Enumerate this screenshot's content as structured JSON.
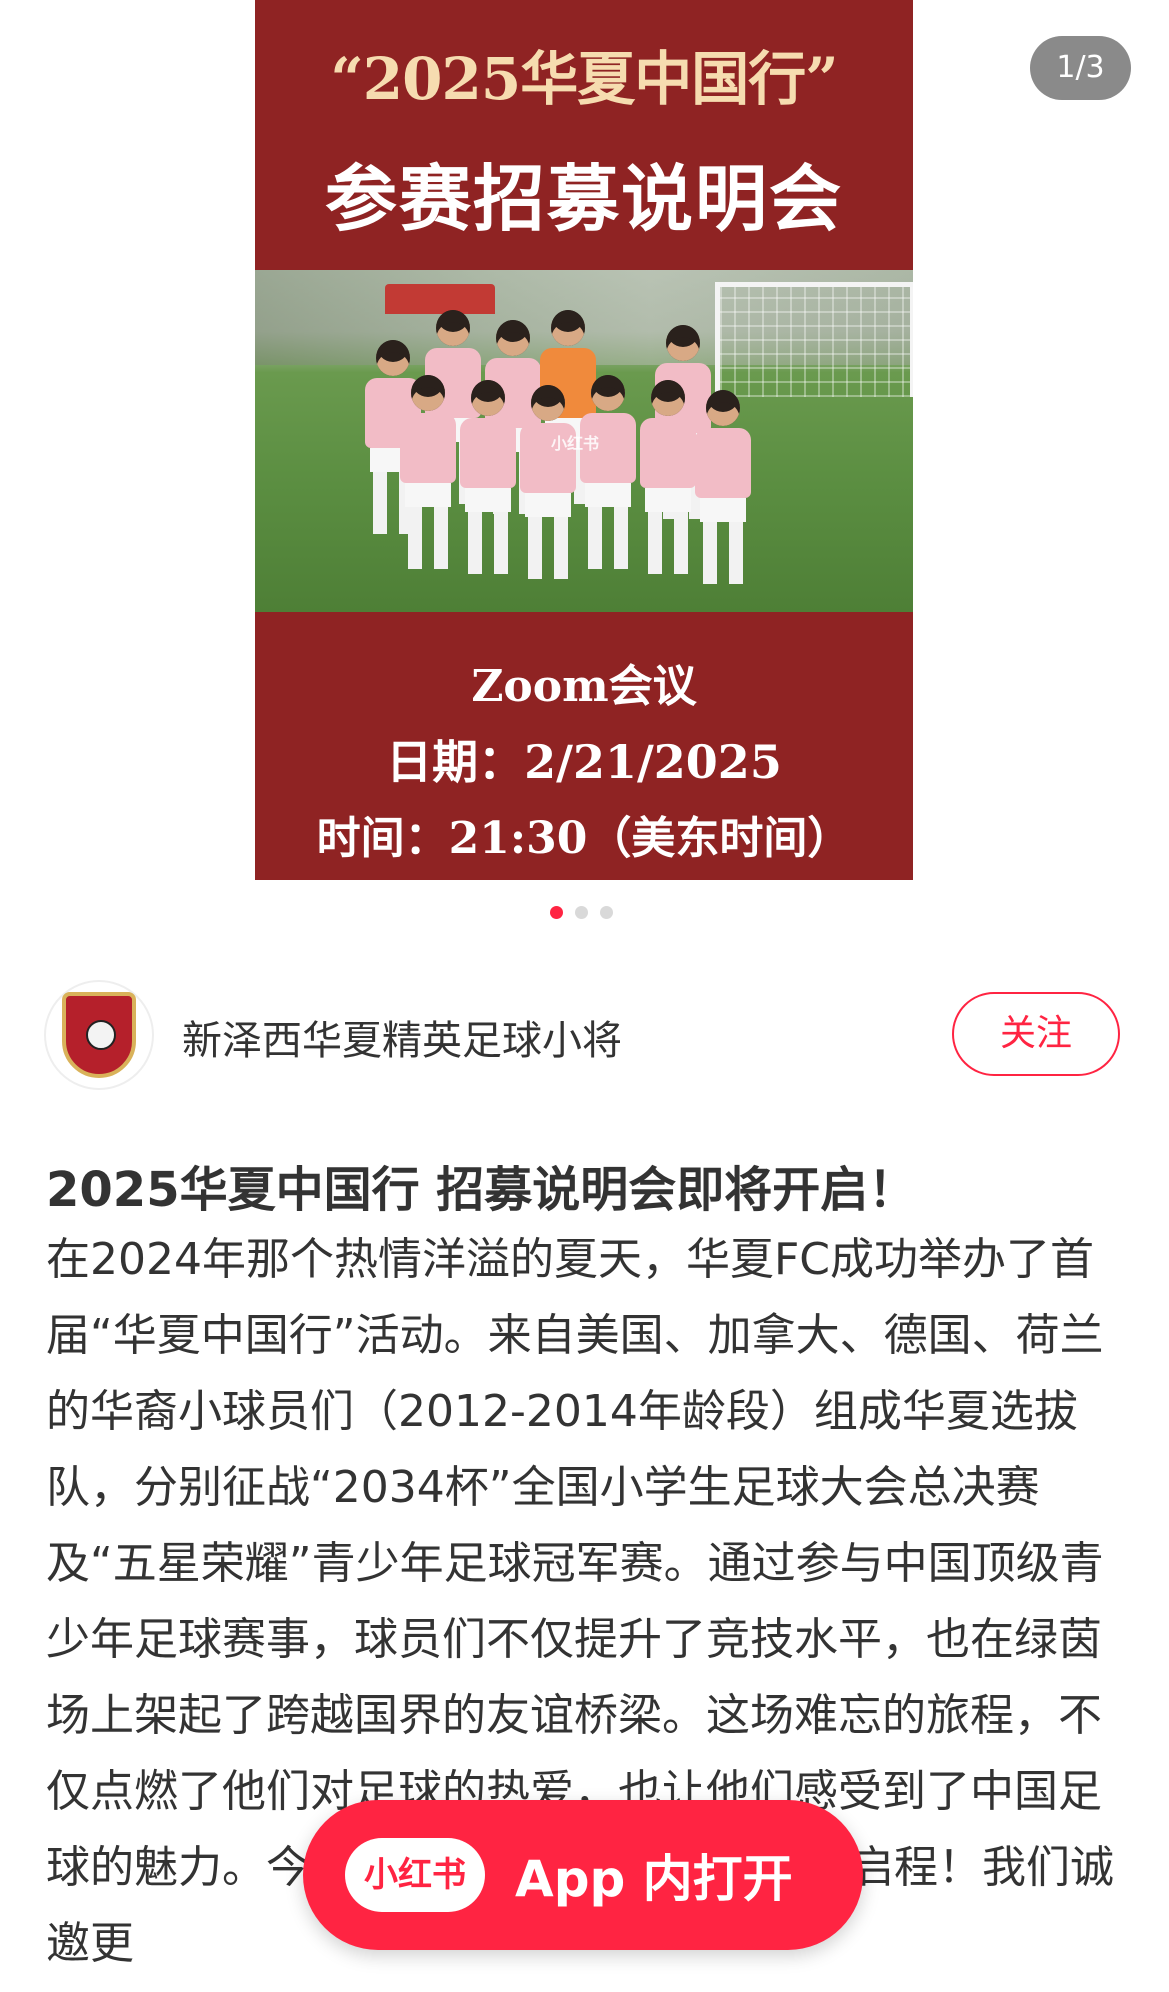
{
  "carousel": {
    "counter": "1/3",
    "dots": 3,
    "active_dot": 1,
    "poster": {
      "title_line1": "“2025华夏中国行”",
      "title_line2": "参赛招募说明会",
      "watermark": "小红书",
      "meeting": "Zoom会议",
      "date": "日期：2/21/2025",
      "time": "时间：21:30（美东时间）"
    }
  },
  "author": {
    "name": "新泽西华夏精英足球小将",
    "follow_label": "关注"
  },
  "post": {
    "title": "2025华夏中国行 招募说明会即将开启！",
    "body": "在2024年那个热情洋溢的夏天，华夏FC成功举办了首届“华夏中国行”活动。来自美国、加拿大、德国、荷兰的华裔小球员们（2012-2014年龄段）组成华夏选拔队，分别征战“2034杯”全国小学生足球大会总决赛及“五星荣耀”青少年足球冠军赛。通过参与中国顶级青少年足球赛事，球员们不仅提升了竞技水平，也在绿茵场上架起了跨越国界的友谊桥梁。这场难忘的旅程，不仅点燃了他们对足球的热爱，也让他们感受到了中国足球的魅力。今夏，华夏FC中国行即将再次启程！我们诚邀更"
  },
  "open_app": {
    "logo": "小红书",
    "label": "App 内打开"
  },
  "colors": {
    "accent": "#ff2442",
    "poster_red": "#8f2323",
    "poster_gold": "#f6dcb0"
  }
}
